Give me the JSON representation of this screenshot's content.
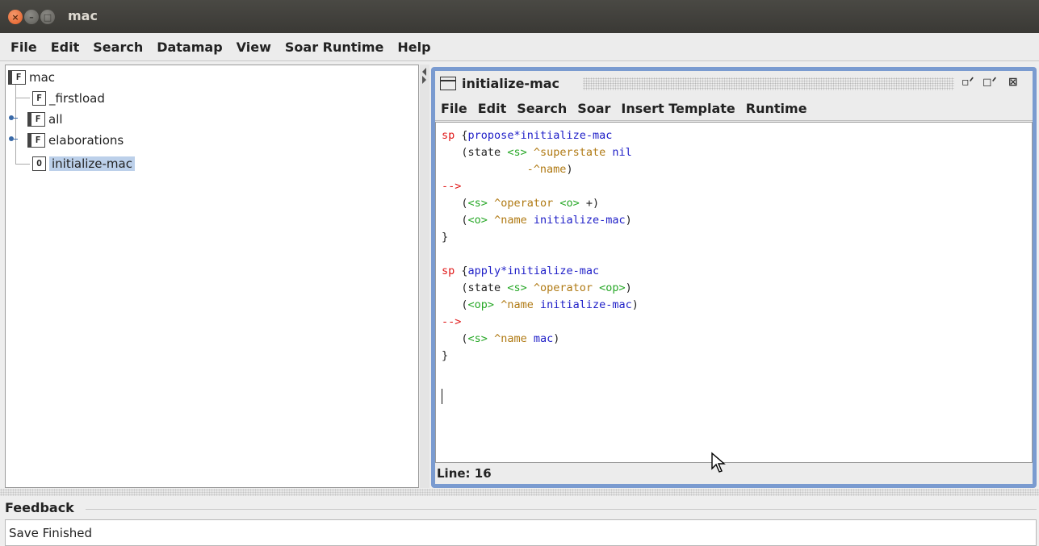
{
  "window": {
    "title": "mac"
  },
  "menubar": {
    "items": [
      "File",
      "Edit",
      "Search",
      "Datamap",
      "View",
      "Soar Runtime",
      "Help"
    ]
  },
  "tree": {
    "root": "mac",
    "children": [
      {
        "label": "_firstload",
        "icon": "file-icon"
      },
      {
        "label": "all",
        "icon": "folder-icon"
      },
      {
        "label": "elaborations",
        "icon": "folder-icon"
      },
      {
        "label": "initialize-mac",
        "icon": "operator-icon",
        "selected": true
      }
    ]
  },
  "editor_window": {
    "title": "initialize-mac",
    "menu": [
      "File",
      "Edit",
      "Search",
      "Soar",
      "Insert Template",
      "Runtime"
    ],
    "status": "Line: 16",
    "code": [
      "sp {propose*initialize-mac",
      "   (state <s> ^superstate nil",
      "             -^name)",
      "-->",
      "   (<s> ^operator <o> +)",
      "   (<o> ^name initialize-mac)",
      "}",
      "",
      "sp {apply*initialize-mac",
      "   (state <s> ^operator <op>)",
      "   (<op> ^name initialize-mac)",
      "-->",
      "   (<s> ^name mac)",
      "}"
    ]
  },
  "feedback": {
    "title": "Feedback",
    "message": "Save Finished"
  },
  "colors": {
    "titlebar": "#3c3b37",
    "frame_border": "#7a9bd0",
    "selection": "#bcd0ea",
    "keyword": "#e01818",
    "identifier": "#2020c8",
    "variable": "#28a828",
    "attribute": "#b07a14"
  }
}
